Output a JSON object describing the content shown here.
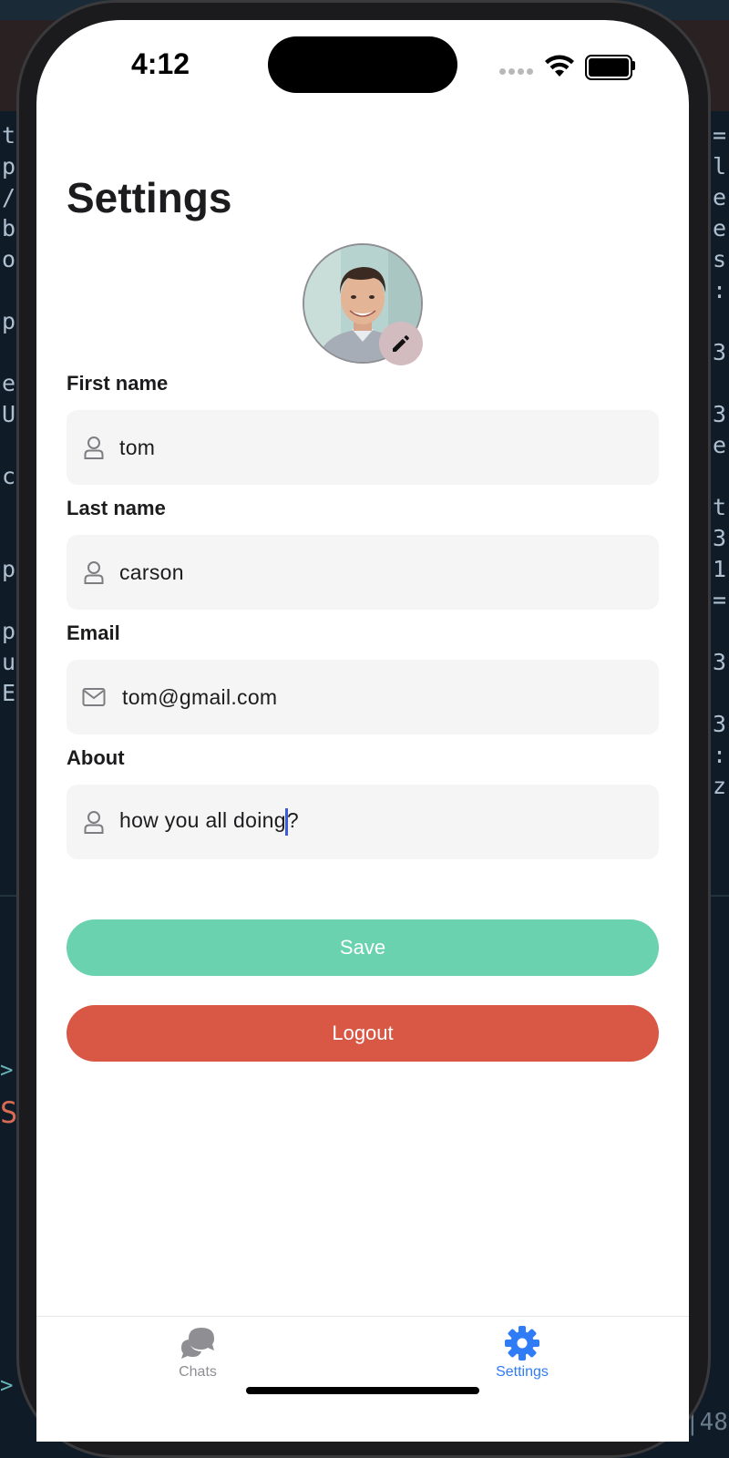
{
  "status_bar": {
    "time": "4:12"
  },
  "page": {
    "title": "Settings"
  },
  "profile": {
    "avatar_icon": "user-photo",
    "edit_icon": "pencil-icon"
  },
  "form": {
    "first_name": {
      "label": "First name",
      "value": "tom",
      "icon": "person-icon"
    },
    "last_name": {
      "label": "Last name",
      "value": "carson",
      "icon": "person-icon"
    },
    "email": {
      "label": "Email",
      "value": "tom@gmail.com",
      "icon": "mail-icon"
    },
    "about": {
      "label": "About",
      "value_before_caret": "how you all doing",
      "value_after_caret": "?",
      "icon": "person-icon"
    }
  },
  "actions": {
    "save_label": "Save",
    "logout_label": "Logout"
  },
  "tabs": [
    {
      "label": "Chats",
      "icon": "chat-bubbles-icon",
      "active": false
    },
    {
      "label": "Settings",
      "icon": "gear-icon",
      "active": true
    }
  ],
  "colors": {
    "save": "#6bd2b0",
    "logout": "#d95745",
    "active_tab": "#2f7cf6",
    "inactive_tab": "#8e8e93",
    "field_bg": "#f4f5f4"
  }
}
